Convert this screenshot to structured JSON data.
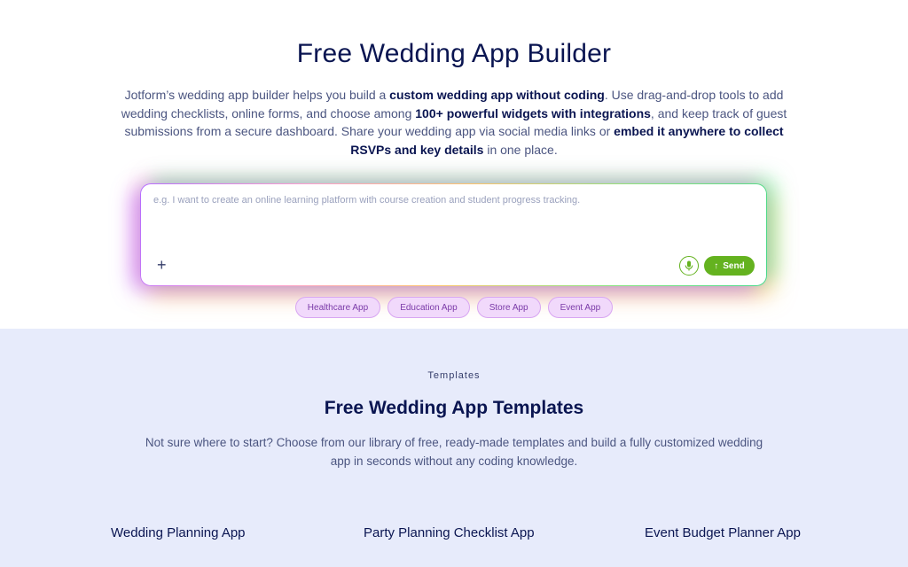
{
  "hero": {
    "title": "Free Wedding App Builder",
    "desc": {
      "p1": "Jotform’s wedding app builder helps you build a ",
      "b1": "custom wedding app without coding",
      "p2": ". Use drag-and-drop tools to add wedding checklists, online forms, and choose among ",
      "b2": "100+ powerful widgets with integrations",
      "p3": ", and keep track of guest submissions from a secure dashboard. Share your wedding app via social media links or ",
      "b3": "embed it anywhere to collect RSVPs and key details",
      "p4": " in one place."
    }
  },
  "prompt": {
    "placeholder": "e.g. I want to create an online learning platform with course creation and student progress tracking.",
    "value": "",
    "plus_icon": "+",
    "mic_icon": "microphone-icon",
    "send_label": "Send",
    "send_icon": "↑",
    "accent": "#64b21f"
  },
  "chips": [
    "Healthcare App",
    "Education App",
    "Store App",
    "Event App"
  ],
  "templates": {
    "eyebrow": "Templates",
    "title": "Free Wedding App Templates",
    "desc": "Not sure where to start? Choose from our library of free, ready-made templates and build a fully customized wedding app in seconds without any coding knowledge.",
    "cards": [
      "Wedding Planning App",
      "Party Planning Checklist App",
      "Event Budget Planner App"
    ]
  }
}
